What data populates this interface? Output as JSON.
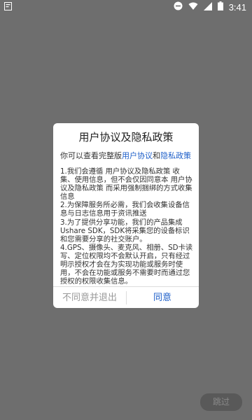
{
  "status_bar": {
    "time": "3:41",
    "icons": [
      "notification-icon",
      "minus-circle-icon",
      "wifi-icon",
      "signal-icon",
      "battery-icon"
    ]
  },
  "dialog": {
    "title": "用户协议及隐私政策",
    "intro_prefix": "你可以查看完整版",
    "intro_link1": "用户协议",
    "intro_and": "和",
    "intro_link2": "隐私政策",
    "paragraphs": [
      "1.我们会遵循 用户协议及隐私政策 收集、使用信息，但不会仅因同意本 用户协议及隐私政策 而采用强制捆绑的方式收集信息",
      "2.为保障服务所必需，我们会收集设备信息与日志信息用于资讯推送",
      "3.为了提供分享功能，我们的产品集成Ushare SDK，SDK将采集您的设备标识和您需要分享的社交账户。",
      "4.GPS、摄像头、麦克风、相册、SD卡读写、定位权限均不会默认开启，只有经过明示授权才会在为实现功能或服务时使用，不会在功能或服务不需要时而通过您授权的权限收集信息。"
    ],
    "disagree_label": "不同意并退出",
    "agree_label": "同意"
  },
  "skip_button": "跳过",
  "colors": {
    "backdrop": "#6e6e6e",
    "link": "#1e5fc9",
    "skip_bg": "#595959"
  }
}
